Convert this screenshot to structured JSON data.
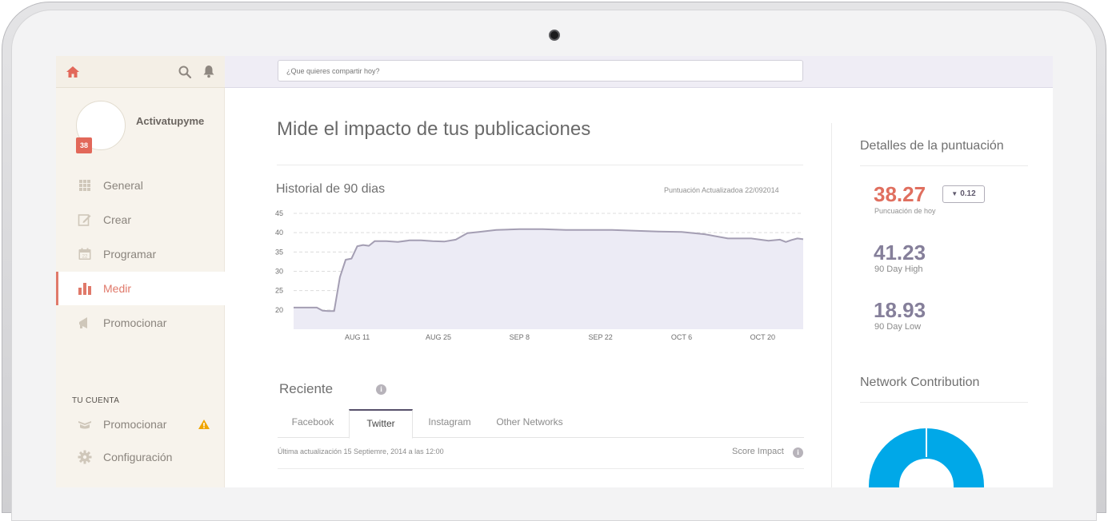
{
  "topbar": {
    "share_placeholder": "¿Que quieres compartir hoy?"
  },
  "sidebar": {
    "username": "Activatupyme",
    "badge_count": "38",
    "nav": [
      {
        "label": "General",
        "icon": "grid-icon"
      },
      {
        "label": "Crear",
        "icon": "edit-icon"
      },
      {
        "label": "Programar",
        "icon": "calendar-icon"
      },
      {
        "label": "Medir",
        "icon": "bar-chart-icon",
        "active": true
      },
      {
        "label": "Promocionar",
        "icon": "megaphone-icon"
      }
    ],
    "account_title": "TU CUENTA",
    "account_items": [
      {
        "label": "Promocionar",
        "icon": "promote-icon",
        "warning": true
      },
      {
        "label": "Configuración",
        "icon": "gear-icon"
      }
    ]
  },
  "main": {
    "page_title": "Mide el impacto de tus publicaciones",
    "chart_title": "Historial de 90 dias",
    "chart_updated": "Puntuación Actualizadoa 22/092014",
    "recent_title": "Reciente",
    "tabs": [
      "Facebook",
      "Twitter",
      "Instagram",
      "Other Networks"
    ],
    "active_tab": "Twitter",
    "last_update": "Última actualización 15 Septiemre, 2014 a las 12:00",
    "score_impact": "Score Impact"
  },
  "chart_data": {
    "type": "area",
    "title": "Historial de 90 dias",
    "xlabel": "",
    "ylabel": "",
    "ylim": [
      15,
      45
    ],
    "yticks": [
      20,
      25,
      30,
      35,
      40,
      45
    ],
    "xtick_labels": [
      "AUG 11",
      "AUG 25",
      "SEP 8",
      "SEP 22",
      "OCT 6",
      "OCT 20"
    ],
    "xlim": [
      "2014-07-31",
      "2014-10-27"
    ],
    "grid": true,
    "colors": {
      "line": "#a49eb3",
      "fill": "#ecebf5"
    },
    "series": [
      {
        "x": [
          "2014-07-31",
          "2014-08-02",
          "2014-08-04",
          "2014-08-05",
          "2014-08-06",
          "2014-08-07",
          "2014-08-08",
          "2014-08-09",
          "2014-08-10",
          "2014-08-11",
          "2014-08-12",
          "2014-08-13",
          "2014-08-14",
          "2014-08-16",
          "2014-08-18",
          "2014-08-20",
          "2014-08-22",
          "2014-08-24",
          "2014-08-26",
          "2014-08-28",
          "2014-08-30",
          "2014-09-01",
          "2014-09-04",
          "2014-09-08",
          "2014-09-12",
          "2014-09-16",
          "2014-09-20",
          "2014-09-24",
          "2014-09-28",
          "2014-10-02",
          "2014-10-06",
          "2014-10-10",
          "2014-10-14",
          "2014-10-18",
          "2014-10-21",
          "2014-10-23",
          "2014-10-24",
          "2014-10-25",
          "2014-10-26",
          "2014-10-27"
        ],
        "y": [
          20.6,
          20.6,
          20.6,
          19.8,
          19.7,
          19.7,
          28.5,
          33.0,
          33.3,
          36.5,
          36.8,
          36.6,
          37.8,
          37.8,
          37.6,
          38.0,
          38.0,
          37.8,
          37.7,
          38.2,
          39.9,
          40.2,
          40.7,
          40.9,
          40.9,
          40.7,
          40.7,
          40.7,
          40.5,
          40.3,
          40.2,
          39.6,
          38.5,
          38.5,
          37.9,
          38.2,
          37.6,
          38.1,
          38.5,
          38.3
        ]
      }
    ]
  },
  "details": {
    "title": "Detalles de la puntuación",
    "score": "38.27",
    "delta": "0.12",
    "score_label": "Puncuación de hoy",
    "high": "41.23",
    "high_label": "90 Day High",
    "low": "18.93",
    "low_label": "90 Day Low",
    "network_title": "Network Contribution",
    "donut": {
      "color": "#00a8e8"
    }
  }
}
